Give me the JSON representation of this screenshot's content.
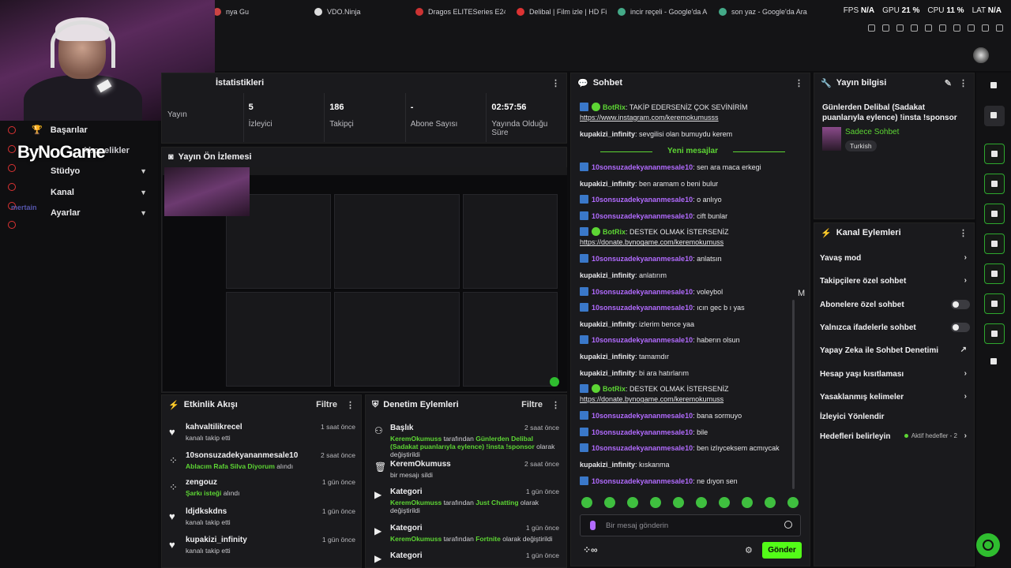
{
  "browser": {
    "tabs": [
      {
        "label": "nya Gu",
        "color": "#c44"
      },
      {
        "label": "VDO.Ninja",
        "color": "#ddd"
      },
      {
        "label": "Dragos ELITESeries E24",
        "color": "#c33"
      },
      {
        "label": "Delibal | Film izle | HD Fil",
        "color": "#d33"
      },
      {
        "label": "incir reçeli - Google'da A",
        "color": "#4a8"
      },
      {
        "label": "son yaz - Google'da Ara",
        "color": "#4a8"
      }
    ],
    "stats": {
      "fps_label": "FPS",
      "fps": "N/A",
      "gpu_label": "GPU",
      "gpu": "21 %",
      "cpu_label": "CPU",
      "cpu": "11 %",
      "lat_label": "LAT",
      "lat": "N/A"
    }
  },
  "sidebar": {
    "logo": "ByNoGame",
    "overlay_logo": "mertain",
    "items": [
      {
        "label": "Başarılar"
      },
      {
        "label": "Stüdyo"
      },
      {
        "label": "Kanal"
      },
      {
        "label": "Ayarlar"
      }
    ],
    "partial_label": "Abonelikler"
  },
  "stats_panel": {
    "title": "İstatistikleri",
    "items": [
      {
        "value": "",
        "label": "Yayın"
      },
      {
        "value": "5",
        "label": "İzleyici"
      },
      {
        "value": "186",
        "label": "Takipçi"
      },
      {
        "value": "-",
        "label": "Abone Sayısı"
      },
      {
        "value": "02:57:56",
        "label": "Yayında Olduğu Süre"
      }
    ]
  },
  "preview": {
    "title": "Yayın Ön İzlemesi"
  },
  "activity": {
    "title": "Etkinlik Akışı",
    "filter": "Filtre",
    "items": [
      {
        "name": "kahvaltilikrecel",
        "sub_pre": "kanalı takip etti",
        "sub_green": "",
        "sub_post": "",
        "time": "1 saat önce",
        "icon": "heart-icon"
      },
      {
        "name": "10sonsuzadekyananmesale10",
        "sub_pre": "",
        "sub_green": "Ablacım Rafa Silva Diyorum",
        "sub_post": " alındı",
        "time": "2 saat önce",
        "icon": "reward-icon"
      },
      {
        "name": "zengouz",
        "sub_pre": "",
        "sub_green": "Şarkı isteği",
        "sub_post": " alındı",
        "time": "1 gün önce",
        "icon": "reward-icon"
      },
      {
        "name": "ldjdkskdns",
        "sub_pre": "kanalı takip etti",
        "sub_green": "",
        "sub_post": "",
        "time": "1 gün önce",
        "icon": "heart-icon"
      },
      {
        "name": "kupakizi_infinity",
        "sub_pre": "kanalı takip etti",
        "sub_green": "",
        "sub_post": "",
        "time": "1 gün önce",
        "icon": "heart-icon"
      }
    ]
  },
  "moderation": {
    "title": "Denetim Eylemleri",
    "filter": "Filtre",
    "items": [
      {
        "name": "Başlık",
        "time": "2 saat önce",
        "green1": "KeremOkumuss",
        "mid": " tarafından ",
        "green2": "Günlerden Delibal (Sadakat puanlarıyla eylence) !insta !sponsor",
        "post": " olarak değiştirildi",
        "plain": ""
      },
      {
        "name": "KeremOkumuss",
        "time": "2 saat önce",
        "green1": "",
        "mid": "",
        "green2": "",
        "post": "",
        "plain": "bir mesajı sildi"
      },
      {
        "name": "Kategori",
        "time": "1 gün önce",
        "green1": "KeremOkumuss",
        "mid": " tarafından ",
        "green2": "Just Chatting",
        "post": " olarak değiştirildi",
        "plain": ""
      },
      {
        "name": "Kategori",
        "time": "1 gün önce",
        "green1": "KeremOkumuss",
        "mid": " tarafından ",
        "green2": "Fortnite",
        "post": " olarak değiştirildi",
        "plain": ""
      },
      {
        "name": "Kategori",
        "time": "1 gün önce",
        "green1": "",
        "mid": "",
        "green2": "",
        "post": "",
        "plain": ""
      }
    ]
  },
  "chat": {
    "title": "Sohbet",
    "new_messages": "Yeni mesajlar",
    "placeholder": "Bir mesaj gönderin",
    "send": "Gönder",
    "messages": [
      {
        "user": "BotRix",
        "type": "bot",
        "text": " TAKİP EDERSENİZ ÇOK SEVİNİRİM",
        "link": "https://www.instagram.com/keremokumusss"
      },
      {
        "user": "kupakizi_infinity",
        "type": "k",
        "text": " sevgilisi olan bumuydu kerem",
        "link": ""
      },
      {
        "user": "10sonsuzadekyananmesale10",
        "type": "u",
        "text": " sen ara maca erkegi",
        "link": ""
      },
      {
        "user": "kupakizi_infinity",
        "type": "k",
        "text": " ben aramam o beni bulur",
        "link": ""
      },
      {
        "user": "10sonsuzadekyananmesale10",
        "type": "u",
        "text": " o anlıyo",
        "link": ""
      },
      {
        "user": "10sonsuzadekyananmesale10",
        "type": "u",
        "text": " cift bunlar",
        "link": ""
      },
      {
        "user": "BotRix",
        "type": "bot",
        "text": " DESTEK OLMAK İSTERSENİZ",
        "link": "https://donate.bynogame.com/keremokumuss"
      },
      {
        "user": "10sonsuzadekyananmesale10",
        "type": "u",
        "text": " anlatsın",
        "link": ""
      },
      {
        "user": "kupakizi_infinity",
        "type": "k",
        "text": " anlatırım",
        "link": ""
      },
      {
        "user": "10sonsuzadekyananmesale10",
        "type": "u",
        "text": " voleybol",
        "link": ""
      },
      {
        "user": "10sonsuzadekyananmesale10",
        "type": "u",
        "text": " ıcın gec b ı yas",
        "link": ""
      },
      {
        "user": "kupakizi_infinity",
        "type": "k",
        "text": " izlerim bence yaa",
        "link": ""
      },
      {
        "user": "10sonsuzadekyananmesale10",
        "type": "u",
        "text": " haberın olsun",
        "link": ""
      },
      {
        "user": "kupakizi_infinity",
        "type": "k",
        "text": " tamamdır",
        "link": ""
      },
      {
        "user": "kupakizi_infinity",
        "type": "k",
        "text": " bi ara hatırlarım",
        "link": ""
      },
      {
        "user": "BotRix",
        "type": "bot",
        "text": " DESTEK OLMAK İSTERSENİZ",
        "link": "https://donate.bynogame.com/keremokumuss"
      },
      {
        "user": "10sonsuzadekyananmesale10",
        "type": "u",
        "text": " bana sormuyo",
        "link": ""
      },
      {
        "user": "10sonsuzadekyananmesale10",
        "type": "u",
        "text": " bile",
        "link": ""
      },
      {
        "user": "10sonsuzadekyananmesale10",
        "type": "u",
        "text": " ben izlıyceksem acmıycak",
        "link": ""
      },
      {
        "user": "kupakizi_infinity",
        "type": "k",
        "text": " kıskanma",
        "link": ""
      },
      {
        "user": "10sonsuzadekyananmesale10",
        "type": "u",
        "text": " ne dıyon sen",
        "link": ""
      }
    ],
    "side_letter": "M"
  },
  "stream_info": {
    "title": "Yayın bilgisi",
    "stream_title": "Günlerden Delibal (Sadakat puanlarıyla eylence) !insta !sponsor",
    "category": "Sadece Sohbet",
    "tag": "Turkish"
  },
  "channel_actions": {
    "title": "Kanal Eylemleri",
    "items": [
      {
        "label": "Yavaş mod",
        "control": "arrow",
        "meta": ""
      },
      {
        "label": "Takipçilere özel sohbet",
        "control": "arrow",
        "meta": ""
      },
      {
        "label": "Abonelere özel sohbet",
        "control": "toggle",
        "meta": ""
      },
      {
        "label": "Yalnızca ifadelerle sohbet",
        "control": "toggle",
        "meta": ""
      },
      {
        "label": "Yapay Zeka ile Sohbet Denetimi",
        "control": "ext",
        "meta": ""
      },
      {
        "label": "Hesap yaşı kısıtlaması",
        "control": "arrow",
        "meta": ""
      },
      {
        "label": "Yasaklanmış kelimeler",
        "control": "arrow",
        "meta": ""
      },
      {
        "label": "İzleyici Yönlendir",
        "control": "none",
        "meta": ""
      },
      {
        "label": "Hedefleri belirleyin",
        "control": "arrow",
        "meta": "Aktif hedefler - 2"
      }
    ]
  },
  "colors": {
    "accent": "#53fc18",
    "bg": "#0d0d0f",
    "panel": "#1a1a1d",
    "username": "#b26bff"
  }
}
